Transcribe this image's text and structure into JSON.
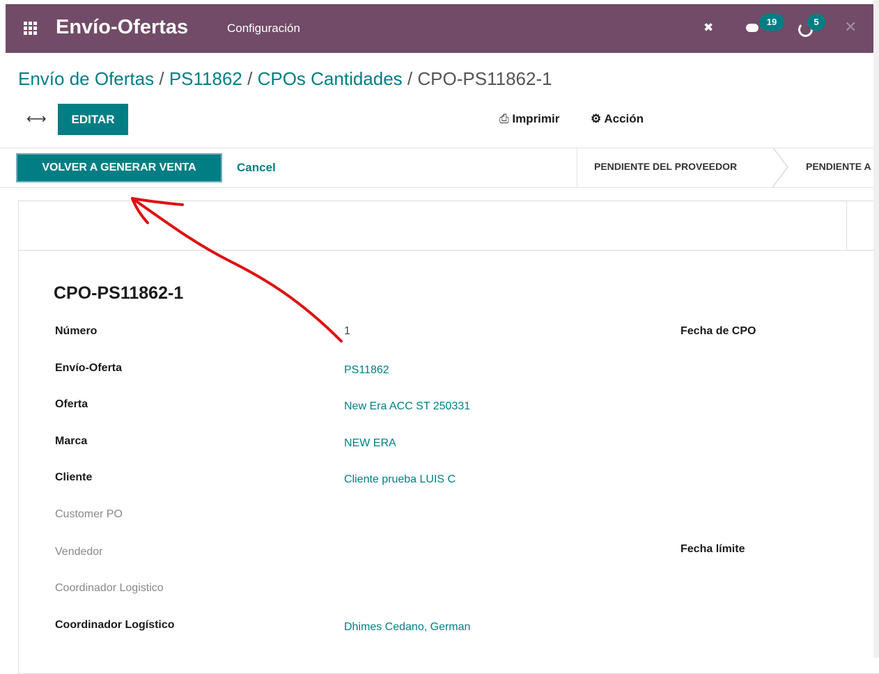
{
  "topbar": {
    "app_title": "Envío-Oferta s",
    "menu_config": "Configuración",
    "messages_count": "19",
    "activities_count": "5",
    "bg_color": "#714b67",
    "badge_color": "#017e84"
  },
  "breadcrumb": {
    "items": [
      "Envío de Ofertas",
      "PS11862",
      "CPOs Cantidades"
    ],
    "separator": "/",
    "current": "CPO-PS11862-1"
  },
  "control_panel": {
    "edit_label": "EDITAR",
    "print_label": "Imprimir",
    "action_label": "Acción"
  },
  "statusbar": {
    "regen_label": "VOLVER A GENERAR VENTA",
    "cancel_label": "Cancel",
    "stages": [
      "PENDIENTE DEL PROVEEDOR",
      "PENDIENTE A"
    ]
  },
  "record": {
    "title": "CPO-PS11862-1",
    "fields": [
      {
        "label": "Número",
        "value": "1"
      },
      {
        "label": "Envío-Oferta",
        "value": "PS11862"
      },
      {
        "label": "Oferta",
        "value": "New Era ACC ST 250331"
      },
      {
        "label": "Marca",
        "value": "NEW ERA"
      },
      {
        "label": "Cliente",
        "value": "Cliente prueba LUIS C"
      },
      {
        "label": "Customer PO",
        "value": ""
      },
      {
        "label": "Vendedor",
        "value": ""
      },
      {
        "label": "Coordinador Logistico",
        "value": ""
      },
      {
        "label": "Coordinador Logístico",
        "value": "Dhimes Cedano, German"
      }
    ],
    "right_labels": [
      "Fecha de CPO",
      "Fecha límite"
    ]
  },
  "accent_color": "#017e84",
  "annotation_color": "#dd1111"
}
